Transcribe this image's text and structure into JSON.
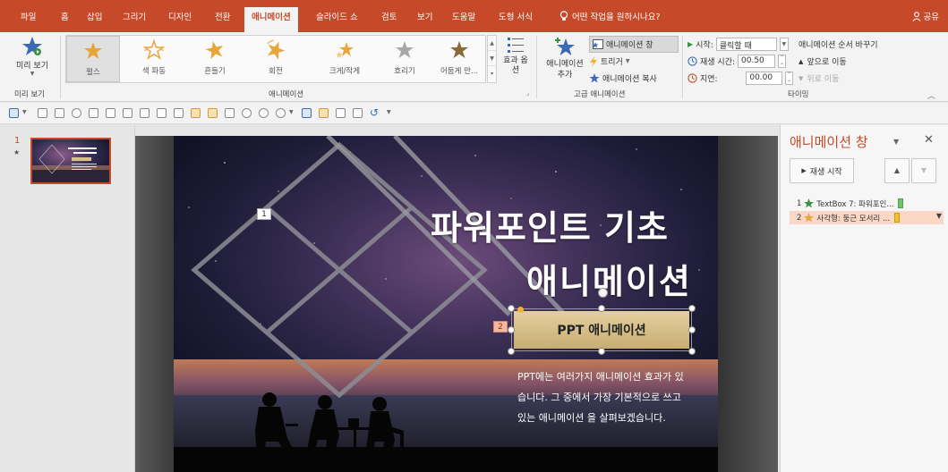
{
  "tabs": [
    {
      "label": "파일"
    },
    {
      "label": "홈"
    },
    {
      "label": "삽입"
    },
    {
      "label": "그리기"
    },
    {
      "label": "디자인"
    },
    {
      "label": "전환"
    },
    {
      "label": "애니메이션",
      "active": true
    },
    {
      "label": "슬라이드 쇼"
    },
    {
      "label": "검토"
    },
    {
      "label": "보기"
    },
    {
      "label": "도움말"
    },
    {
      "label": "도형 서식"
    }
  ],
  "tell_me": "어떤 작업을 원하시나요?",
  "share": "공유",
  "ribbon": {
    "preview_label": "미리 보기",
    "preview_group": "미리 보기",
    "animation_group": "애니메이션",
    "effects": [
      {
        "label": "펄스",
        "icon": "pulse-star-icon",
        "color": "#e8a53a",
        "selected": true
      },
      {
        "label": "색 파동",
        "icon": "color-wave-icon",
        "color": "#e8a53a"
      },
      {
        "label": "흔들기",
        "icon": "teeter-star-icon",
        "color": "#e8a53a"
      },
      {
        "label": "회전",
        "icon": "spin-star-icon",
        "color": "#e8a53a"
      },
      {
        "label": "크게/작게",
        "icon": "grow-shrink-icon",
        "color": "#e8a53a"
      },
      {
        "label": "흐리기",
        "icon": "desaturate-star-icon",
        "color": "#a8a8a8"
      },
      {
        "label": "어둡게 만...",
        "icon": "darken-star-icon",
        "color": "#8a6a3a"
      }
    ],
    "effect_options": "효과 옵션",
    "add_animation": "애니메이션 추가",
    "animation_pane": "애니메이션 창",
    "trigger": "트리거",
    "painter": "애니메이션 복사",
    "advanced_group": "고급 애니메이션",
    "start_label": "시작:",
    "start_value": "클릭할 때",
    "duration_label": "재생 시간:",
    "duration_value": "00.50",
    "delay_label": "지연:",
    "delay_value": "00.00",
    "reorder_title": "애니메이션 순서 바꾸기",
    "move_earlier": "앞으로 이동",
    "move_later": "뒤로 이동",
    "timing_group": "타이밍"
  },
  "thumb": {
    "number": "1",
    "mark": "★"
  },
  "slide": {
    "title_line1": "파워포인트 기초",
    "title_line2": "애니메이션",
    "button_label": "PPT 애니메이션",
    "body_line1": "PPT에는 여러가지 애니메이션 효과가 있",
    "body_line2": "습니다. 그 중에서 가장 기본적으로 쓰고",
    "body_line3": "있는 애니메이션 을 살펴보겠습니다.",
    "tag1": "1",
    "tag2": "2"
  },
  "pane": {
    "title": "애니메이션 창",
    "play": "재생 시작",
    "items": [
      {
        "num": "1",
        "label": "TextBox 7: 파워포인...",
        "star_color": "#3a8f46",
        "bar_color": "#6cc36c"
      },
      {
        "num": "2",
        "label": "사각형: 둥근 모서리 ...",
        "star_color": "#e8a53a",
        "bar_color": "#f2c231"
      }
    ]
  }
}
